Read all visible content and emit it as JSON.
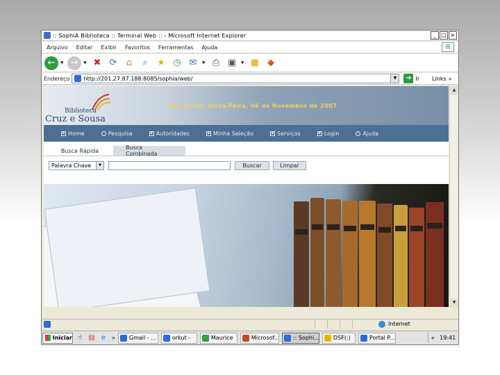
{
  "window": {
    "title": ":: SophiA Biblioteca :: Terminal Web :: - Microsoft Internet Explorer",
    "controls": [
      "_",
      "□",
      "×"
    ]
  },
  "menubar": [
    "Arquivo",
    "Editar",
    "Exibir",
    "Favoritos",
    "Ferramentas",
    "Ajuda"
  ],
  "toolbar": {
    "buttons": [
      "back-icon",
      "forward-icon",
      "stop-icon",
      "refresh-icon",
      "home-icon",
      "search-icon",
      "favorites-icon",
      "history-icon",
      "mail-icon",
      "print-icon",
      "edit-icon",
      "folder-icon",
      "messenger-icon"
    ]
  },
  "address": {
    "label": "Endereço",
    "url": "http://201.27.87.188:8085/sophia/web/",
    "go_label": "Ir",
    "links_label": "Links",
    "links_chevron": "»"
  },
  "page": {
    "logo_small": "Biblioteca",
    "logo_big": "Cruz e Sousa",
    "greeting": "Boa Noite! Terça-Feira, 06 de Novembro de 2007",
    "nav": [
      "Home",
      "Pesquisa",
      "Autoridades",
      "Minha Seleção",
      "Serviços",
      "Login",
      "Ajuda"
    ],
    "tabs": [
      "Busca Rápida",
      "Busca Combinada"
    ],
    "search": {
      "select_value": "Palavra Chave",
      "input_value": "",
      "search_button": "Buscar",
      "clear_button": "Limpar"
    }
  },
  "statusbar": {
    "zone": "Internet"
  },
  "taskbar": {
    "start": "Iniciar",
    "chevron": "»",
    "tasks": [
      "Gmail - ...",
      "orkut -",
      "Maurice",
      "Microsof...",
      ":: Sophi...",
      "DSF(:)",
      "Portal P..."
    ],
    "active_task": 4,
    "tray_chevron": "«",
    "clock": "19:41"
  },
  "colors": {
    "nav_bg": "#4d6f93",
    "greeting": "#f0d25a",
    "banner_dark": "#7990a8"
  }
}
